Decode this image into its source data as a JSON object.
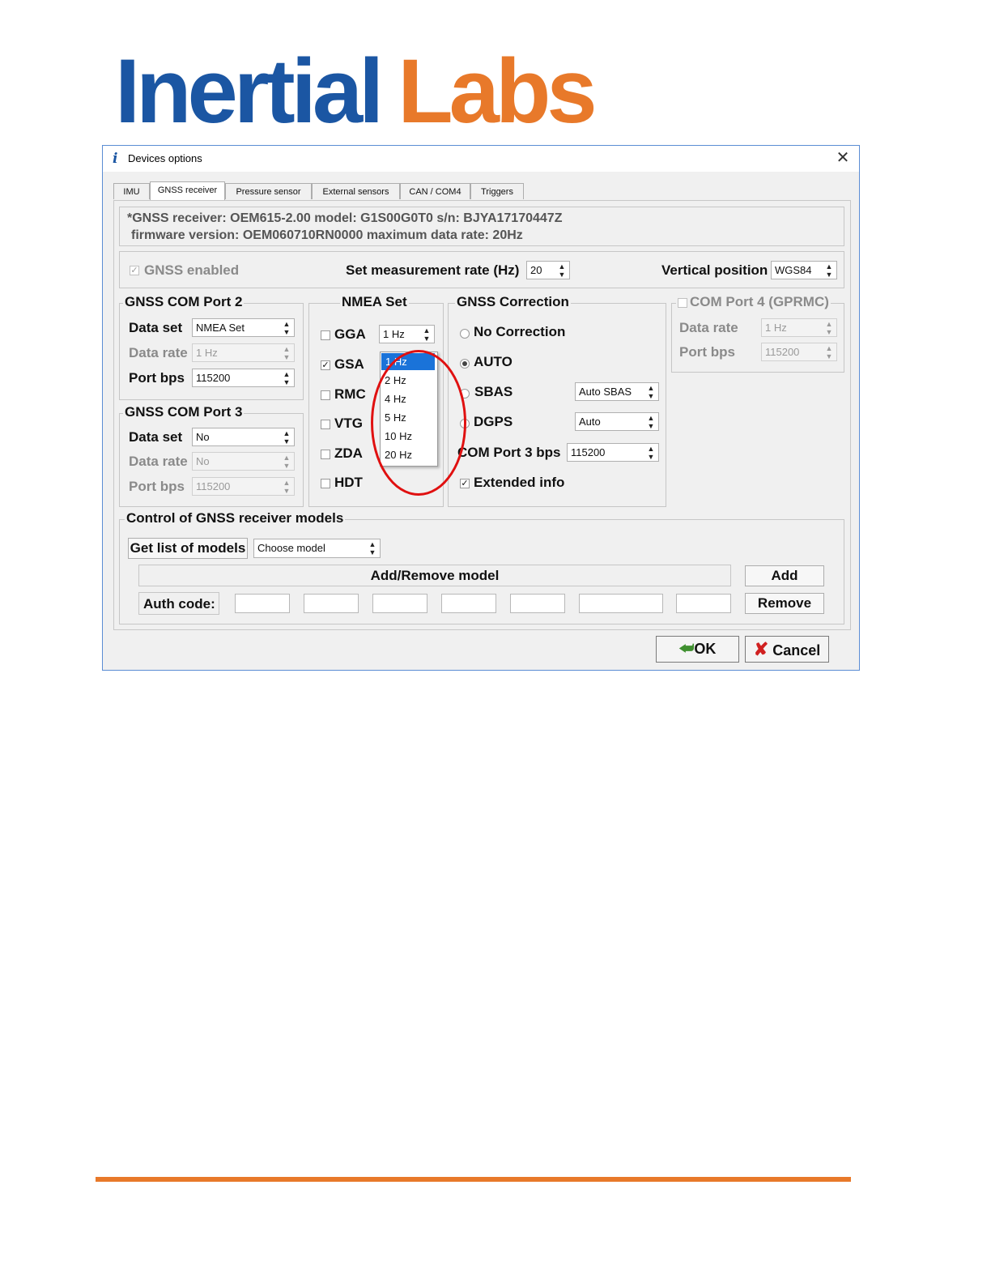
{
  "logo": {
    "part1": "Inertial",
    "part2": "Labs"
  },
  "dialog": {
    "title": "Devices options",
    "tabs": [
      "IMU",
      "GNSS receiver",
      "Pressure sensor",
      "External sensors",
      "CAN / COM4",
      "Triggers"
    ],
    "info_line1": "*GNSS receiver: OEM615-2.00 model: G1S00G0T0 s/n: BJYA17170447Z",
    "info_line2": "firmware version: OEM060710RN0000 maximum data rate: 20Hz",
    "gnss_enabled": "GNSS enabled",
    "meas_rate_label": "Set measurement rate (Hz)",
    "meas_rate_value": "20",
    "vertical_position_label": "Vertical position",
    "vertical_position_value": "WGS84",
    "port2": {
      "title": "GNSS COM Port 2",
      "data_set_label": "Data set",
      "data_set_value": "NMEA Set",
      "data_rate_label": "Data rate",
      "data_rate_value": "1 Hz",
      "port_bps_label": "Port bps",
      "port_bps_value": "115200"
    },
    "port3": {
      "title": "GNSS COM Port 3",
      "data_set_label": "Data set",
      "data_set_value": "No",
      "data_rate_label": "Data rate",
      "data_rate_value": "No",
      "port_bps_label": "Port bps",
      "port_bps_value": "115200"
    },
    "nmea": {
      "title": "NMEA Set",
      "items": [
        "GGA",
        "GSA",
        "RMC",
        "VTG",
        "ZDA",
        "HDT"
      ],
      "gga_rate": "1 Hz",
      "dropdown_options": [
        "1 Hz",
        "2 Hz",
        "4 Hz",
        "5 Hz",
        "10 Hz",
        "20 Hz"
      ]
    },
    "correction": {
      "title": "GNSS Correction",
      "no_correction": "No Correction",
      "auto": "AUTO",
      "sbas": "SBAS",
      "sbas_value": "Auto SBAS",
      "dgps": "DGPS",
      "dgps_value": "Auto",
      "com3_bps_label": "COM Port 3 bps",
      "com3_bps_value": "115200",
      "extended_info": "Extended info"
    },
    "port4": {
      "title": "COM Port 4 (GPRMC)",
      "data_rate_label": "Data rate",
      "data_rate_value": "1 Hz",
      "port_bps_label": "Port bps",
      "port_bps_value": "115200"
    },
    "models": {
      "title": "Control of GNSS receiver models",
      "get_list": "Get list of models",
      "choose_model": "Choose model",
      "add_remove": "Add/Remove model",
      "add": "Add",
      "auth_code": "Auth code:",
      "remove": "Remove"
    },
    "ok": "OK",
    "cancel": "Cancel"
  },
  "colors": {
    "logo_blue": "#1b56a3",
    "logo_orange": "#e8792a",
    "selection": "#1a73d9",
    "annotation_red": "#e01010"
  }
}
